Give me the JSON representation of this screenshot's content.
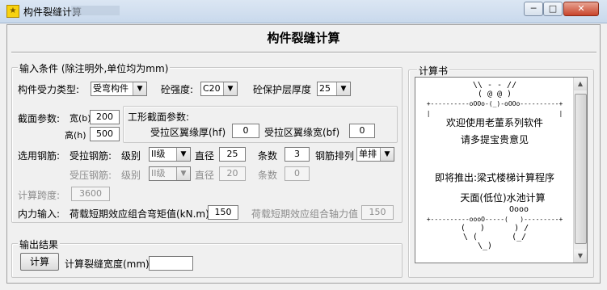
{
  "window": {
    "title": "构件裂缝计算",
    "minimize": "─",
    "maximize": "□",
    "close": "✕"
  },
  "app_title": "构件裂缝计算",
  "input_group": {
    "legend": "输入条件 (除注明外,单位均为mm)",
    "force_type_label": "构件受力类型:",
    "force_type_value": "受弯构件",
    "concrete_label": "砼强度:",
    "concrete_value": "C20",
    "cover_label": "砼保护层厚度",
    "cover_value": "25",
    "section_label": "截面参数:",
    "width_label": "宽(b)",
    "width_value": "200",
    "height_label": "高(h)",
    "height_value": "500",
    "t_section": {
      "title": "工形截面参数:",
      "tension_flange_label": "受拉区翼缘厚(hf)",
      "tension_flange_value": "0",
      "compression_flange_label": "受拉区翼缘宽(bf)",
      "compression_flange_value": "0"
    },
    "rebar_label": "选用钢筋:",
    "tension_rebar": {
      "label": "受拉钢筋:",
      "grade_label": "级别",
      "grade_value": "II级",
      "dia_label": "直径",
      "dia_value": "25",
      "count_label": "条数",
      "count_value": "3",
      "arrange_label": "钢筋排列",
      "arrange_value": "单排"
    },
    "compression_rebar": {
      "label": "受压钢筋:",
      "grade_label": "级别",
      "grade_value": "II级",
      "dia_label": "直径",
      "dia_value": "20",
      "count_label": "条数",
      "count_value": "0"
    },
    "span_label": "计算跨度:",
    "span_value": "3600",
    "load_label": "内力输入:",
    "moment_label": "荷载短期效应组合弯矩值(kN.m)",
    "moment_value": "150",
    "axial_label": "荷载短期效应组合轴力值",
    "axial_value": "150"
  },
  "output_group": {
    "legend": "输出结果",
    "calc_button": "计算",
    "crack_label": "计算裂缝宽度(mm)",
    "crack_value": ""
  },
  "calc_book": {
    "legend": "计算书",
    "lines": [
      "\\\\ - - //",
      "( @ @ )",
      "+----------oOOo-(_)-oOOo----------+",
      "|                                 |",
      "欢迎使用老董系列软件",
      "请多提宝贵意见",
      "即将推出:梁式楼梯计算程序",
      "天面(低位)水池计算",
      "Oooo",
      "+----------oooO-----(   )---------+",
      "(   )      ) /",
      "\\ (       (_/",
      "\\_)"
    ]
  },
  "colors": {
    "titlebar": "#c9d9ec",
    "close": "#c8442b",
    "window_bg": "#f0f0f0"
  }
}
